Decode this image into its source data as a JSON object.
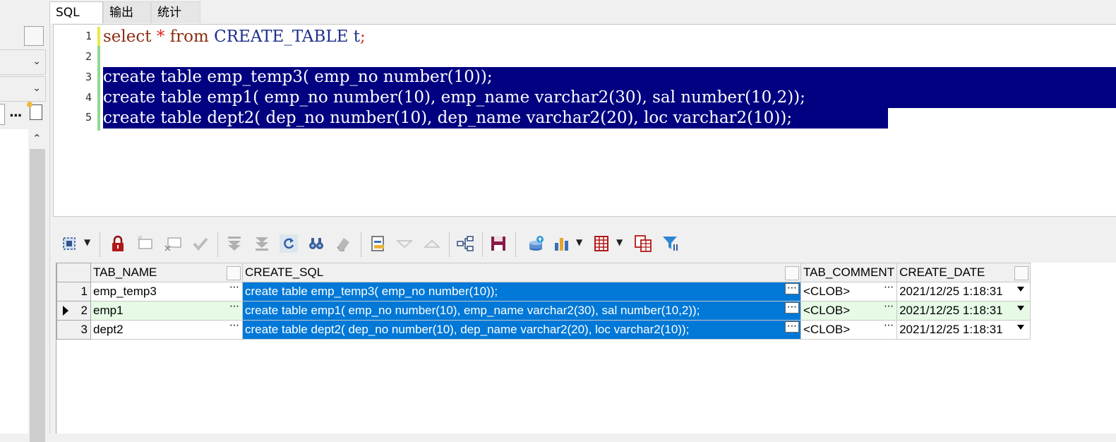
{
  "tabs": [
    {
      "label": "SQL",
      "active": true
    },
    {
      "label": "输出",
      "active": false
    },
    {
      "label": "统计",
      "active": false
    }
  ],
  "editor": {
    "line_numbers": [
      "1",
      "2",
      "3",
      "4",
      "5"
    ],
    "line1": {
      "kw_select": "select",
      "op_star": "*",
      "kw_from": "from",
      "ident": "CREATE_TABLE t",
      "op_semi": ";"
    },
    "line3": "create table emp_temp3( emp_no number(10));",
    "line4": "create table emp1( emp_no number(10), emp_name varchar2(30), sal number(10,2));",
    "line5": "create table dept2( dep_no number(10), dep_name varchar2(20), loc varchar2(10));",
    "selection_color": "#000080"
  },
  "toolbar": {
    "icons": [
      "select-columns-icon",
      "lock-icon",
      "insert-record-icon",
      "delete-record-icon",
      "post-changes-icon",
      "first-record-icon",
      "last-record-icon",
      "refresh-icon",
      "find-icon",
      "clear-icon",
      "single-record-view-icon",
      "next-icon",
      "previous-icon",
      "query-builder-icon",
      "save-icon",
      "export-icon",
      "chart-icon",
      "grid-view-icon",
      "record-compare-icon",
      "filter-icon"
    ]
  },
  "grid": {
    "columns": [
      "TAB_NAME",
      "CREATE_SQL",
      "TAB_COMMENT",
      "CREATE_DATE"
    ],
    "rows": [
      {
        "num": "1",
        "tab_name": "emp_temp3",
        "create_sql": "create table emp_temp3( emp_no number(10));",
        "tab_comment": "<CLOB>",
        "create_date": "2021/12/25 1:18:31"
      },
      {
        "num": "2",
        "tab_name": "emp1",
        "create_sql": "create table emp1( emp_no number(10), emp_name varchar2(30), sal number(10,2));",
        "tab_comment": "<CLOB>",
        "create_date": "2021/12/25 1:18:31"
      },
      {
        "num": "3",
        "tab_name": "dept2",
        "create_sql": "create table dept2( dep_no number(10), dep_name varchar2(20), loc varchar2(10));",
        "tab_comment": "<CLOB>",
        "create_date": "2021/12/25 1:18:31"
      }
    ],
    "current_row": "2",
    "selected_cell_color": "#0078d7",
    "current_row_color": "#e6fae6"
  },
  "left_panel": {
    "ellipsis": "..."
  }
}
